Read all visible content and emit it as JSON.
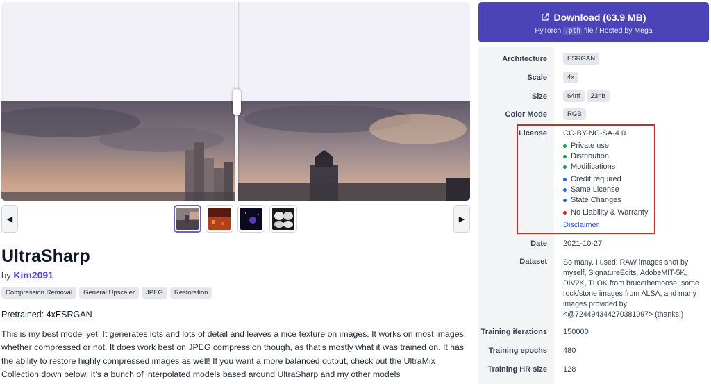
{
  "navigation": {
    "prev_icon": "◀",
    "next_icon": "▶"
  },
  "model": {
    "title": "UltraSharp",
    "by_label": "by",
    "author": "Kim2091",
    "tags": [
      "Compression Removal",
      "General Upscaler",
      "JPEG",
      "Restoration"
    ],
    "pretrained": "Pretrained: 4xESRGAN",
    "description": "This is my best model yet! It generates lots and lots of detail and leaves a nice texture on images. It works on most images, whether compressed or not. It does work best on JPEG compression though, as that's mostly what it was trained on. It has the ability to restore highly compressed images as well! If you want a more balanced output, check out the UltraMix Collection down below. It's a bunch of interpolated models based around UltraSharp and my other models"
  },
  "download": {
    "icon": "external-link-icon",
    "label": "Download (63.9 MB)",
    "sub_prefix": "PyTorch ",
    "sub_ext": ".pth",
    "sub_suffix": " file / Hosted by Mega"
  },
  "info": {
    "labels": {
      "architecture": "Architecture",
      "scale": "Scale",
      "size": "Size",
      "color_mode": "Color Mode",
      "license": "License",
      "date": "Date",
      "dataset": "Dataset",
      "training_iterations": "Training iterations",
      "training_epochs": "Training epochs",
      "training_hr_size": "Training HR size"
    },
    "architecture": "ESRGAN",
    "scale": "4x",
    "size": [
      "64nf",
      "23nb"
    ],
    "color_mode": "RGB",
    "license": {
      "name": "CC-BY-NC-SA-4.0",
      "permissions": [
        "Private use",
        "Distribution",
        "Modifications"
      ],
      "conditions": [
        "Credit required",
        "Same License",
        "State Changes"
      ],
      "limitations": [
        "No Liability & Warranty"
      ],
      "disclaimer": "Disclaimer",
      "colors": {
        "permission": "#16a34a",
        "condition": "#2563eb",
        "limitation": "#dc2626",
        "highlight_border": "#e02222"
      }
    },
    "date": "2021-10-27",
    "dataset": "So many. I used: RAW images shot by myself, SignatureEdits, AdobeMIT-5K, DIV2K, TLOK from brucethemoose, some rock/stone images from ALSA, and many images provided by <@724494344270381097> (thanks!)",
    "training_iterations": "150000",
    "training_epochs": "480",
    "training_hr_size": "128"
  },
  "colors": {
    "accent": "#4c43b8",
    "author_link": "#4f46e5"
  }
}
